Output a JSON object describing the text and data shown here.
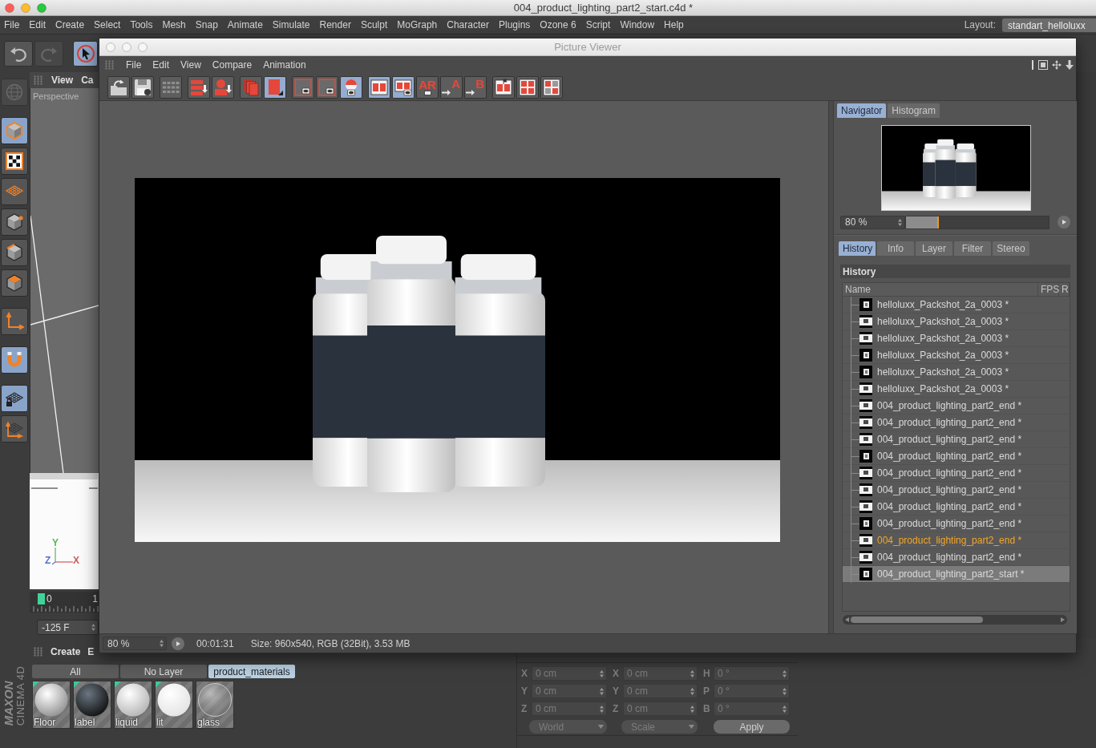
{
  "window": {
    "title": "004_product_lighting_part2_start.c4d *"
  },
  "menu": [
    "File",
    "Edit",
    "Create",
    "Select",
    "Tools",
    "Mesh",
    "Snap",
    "Animate",
    "Simulate",
    "Render",
    "Sculpt",
    "MoGraph",
    "Character",
    "Plugins",
    "Ozone 6",
    "Script",
    "Window",
    "Help"
  ],
  "layout": {
    "label": "Layout:",
    "value": "standart_helloluxx"
  },
  "top_tools": [
    {
      "kind": "undo",
      "on": false,
      "disabled": false
    },
    {
      "kind": "redo",
      "on": false,
      "disabled": true
    },
    {
      "kind": "select",
      "on": true,
      "disabled": false
    }
  ],
  "tool_strip": [
    [
      {
        "kind": "sculpt",
        "on": false,
        "disabled": true
      }
    ],
    [
      {
        "kind": "model",
        "on": true,
        "disabled": false
      },
      {
        "kind": "texture",
        "on": false,
        "disabled": false
      },
      {
        "kind": "workplane",
        "on": false,
        "disabled": false
      },
      {
        "kind": "points",
        "on": false,
        "disabled": false
      },
      {
        "kind": "edges",
        "on": false,
        "disabled": false
      },
      {
        "kind": "polygons",
        "on": false,
        "disabled": false
      }
    ],
    [
      {
        "kind": "axis",
        "on": false,
        "disabled": false
      }
    ],
    [
      {
        "kind": "snap",
        "on": true,
        "disabled": false
      }
    ],
    [
      {
        "kind": "lock",
        "on": true,
        "disabled": false
      },
      {
        "kind": "plane-axis",
        "on": false,
        "disabled": false
      }
    ]
  ],
  "viewport": {
    "menu": [
      "View",
      "Ca"
    ],
    "label": "Perspective",
    "axes": [
      {
        "label": "Y",
        "color": "#58b85a"
      },
      {
        "label": "Z",
        "color": "#5b6fd0"
      },
      {
        "label": "X",
        "color": "#d05a5a"
      }
    ]
  },
  "timeline": {
    "marks": [
      "0",
      "1"
    ],
    "frame": "-125 F"
  },
  "picture_viewer": {
    "title": "Picture Viewer",
    "menu": [
      "File",
      "Edit",
      "View",
      "Compare",
      "Animation"
    ],
    "toolbar": [
      [
        {
          "kind": "open",
          "on": false
        },
        {
          "kind": "save",
          "on": false
        }
      ],
      [
        {
          "kind": "filter",
          "on": false
        }
      ],
      [
        {
          "kind": "export-stack",
          "on": false
        },
        {
          "kind": "export-down",
          "on": false
        }
      ],
      [
        {
          "kind": "doc-stack",
          "on": false
        },
        {
          "kind": "doc-single",
          "on": true
        }
      ],
      [
        {
          "kind": "frame-eye",
          "on": false
        },
        {
          "kind": "frame-eye",
          "on": false
        },
        {
          "kind": "sphere-eye",
          "on": true
        }
      ],
      [
        {
          "kind": "ab",
          "on": true
        },
        {
          "kind": "ab-eye",
          "on": true
        },
        {
          "kind": "letter",
          "label": "AR",
          "on": false
        },
        {
          "kind": "letter-arrow",
          "label": "A",
          "on": false
        },
        {
          "kind": "letter-arrow",
          "label": "B",
          "on": false
        }
      ],
      [
        {
          "kind": "split",
          "on": false
        },
        {
          "kind": "split-grid",
          "on": false
        },
        {
          "kind": "split-quad",
          "on": false
        }
      ]
    ],
    "side_tabs": [
      {
        "label": "Navigator",
        "selected": true
      },
      {
        "label": "Histogram",
        "selected": false
      }
    ],
    "zoom": {
      "value": "80 %",
      "level": 0.23
    },
    "panel_tabs": [
      {
        "label": "History",
        "selected": true
      },
      {
        "label": "Info",
        "selected": false
      },
      {
        "label": "Layer",
        "selected": false
      },
      {
        "label": "Filter",
        "selected": false
      },
      {
        "label": "Stereo",
        "selected": false
      }
    ],
    "history": {
      "title": "History",
      "columns": [
        "Name",
        "FPS",
        "R"
      ],
      "rows": [
        {
          "name": "helloluxx_Packshot_2a_0003 *",
          "kind": "dark",
          "selected": false,
          "current": false
        },
        {
          "name": "helloluxx_Packshot_2a_0003 *",
          "kind": "light",
          "selected": false,
          "current": false
        },
        {
          "name": "helloluxx_Packshot_2a_0003 *",
          "kind": "light",
          "selected": false,
          "current": false
        },
        {
          "name": "helloluxx_Packshot_2a_0003 *",
          "kind": "dark",
          "selected": false,
          "current": false
        },
        {
          "name": "helloluxx_Packshot_2a_0003 *",
          "kind": "dark",
          "selected": false,
          "current": false
        },
        {
          "name": "helloluxx_Packshot_2a_0003 *",
          "kind": "light",
          "selected": false,
          "current": false
        },
        {
          "name": "004_product_lighting_part2_end *",
          "kind": "light",
          "selected": false,
          "current": false
        },
        {
          "name": "004_product_lighting_part2_end *",
          "kind": "light",
          "selected": false,
          "current": false
        },
        {
          "name": "004_product_lighting_part2_end *",
          "kind": "light",
          "selected": false,
          "current": false
        },
        {
          "name": "004_product_lighting_part2_end *",
          "kind": "dark",
          "selected": false,
          "current": false
        },
        {
          "name": "004_product_lighting_part2_end *",
          "kind": "light",
          "selected": false,
          "current": false
        },
        {
          "name": "004_product_lighting_part2_end *",
          "kind": "light",
          "selected": false,
          "current": false
        },
        {
          "name": "004_product_lighting_part2_end *",
          "kind": "light",
          "selected": false,
          "current": false
        },
        {
          "name": "004_product_lighting_part2_end *",
          "kind": "dark",
          "selected": false,
          "current": false
        },
        {
          "name": "004_product_lighting_part2_end *",
          "kind": "light",
          "selected": false,
          "current": true
        },
        {
          "name": "004_product_lighting_part2_end *",
          "kind": "light",
          "selected": false,
          "current": false
        },
        {
          "name": "004_product_lighting_part2_start *",
          "kind": "dark",
          "selected": true,
          "current": false
        }
      ]
    },
    "status": {
      "zoom": "80 %",
      "time": "00:01:31",
      "info": "Size: 960x540, RGB (32Bit), 3.53 MB"
    }
  },
  "logo": {
    "brand": "MAXON",
    "product": "CINEMA 4D"
  },
  "materials": {
    "menu": [
      "Create",
      "E"
    ],
    "filters": [
      {
        "label": "All",
        "selected": false
      },
      {
        "label": "No Layer",
        "selected": false
      },
      {
        "label": "product_materials",
        "selected": true
      }
    ],
    "items": [
      {
        "name": "Floor",
        "kind": "glossy",
        "tagged": true
      },
      {
        "name": "label",
        "kind": "dark",
        "tagged": true
      },
      {
        "name": "liquid",
        "kind": "pearl",
        "tagged": true
      },
      {
        "name": "lit",
        "kind": "bright",
        "tagged": true
      },
      {
        "name": "glass",
        "kind": "glass",
        "tagged": false
      }
    ]
  },
  "coordinates": {
    "disabled": true,
    "rows": [
      {
        "position_axis": "X",
        "position": "0 cm",
        "size_axis": "X",
        "size": "0 cm",
        "rotation_axis": "H",
        "rotation": "0 °"
      },
      {
        "position_axis": "Y",
        "position": "0 cm",
        "size_axis": "Y",
        "size": "0 cm",
        "rotation_axis": "P",
        "rotation": "0 °"
      },
      {
        "position_axis": "Z",
        "position": "0 cm",
        "size_axis": "Z",
        "size": "0 cm",
        "rotation_axis": "B",
        "rotation": "0 °"
      }
    ],
    "space": "World",
    "mode": "Scale",
    "apply": "Apply"
  }
}
